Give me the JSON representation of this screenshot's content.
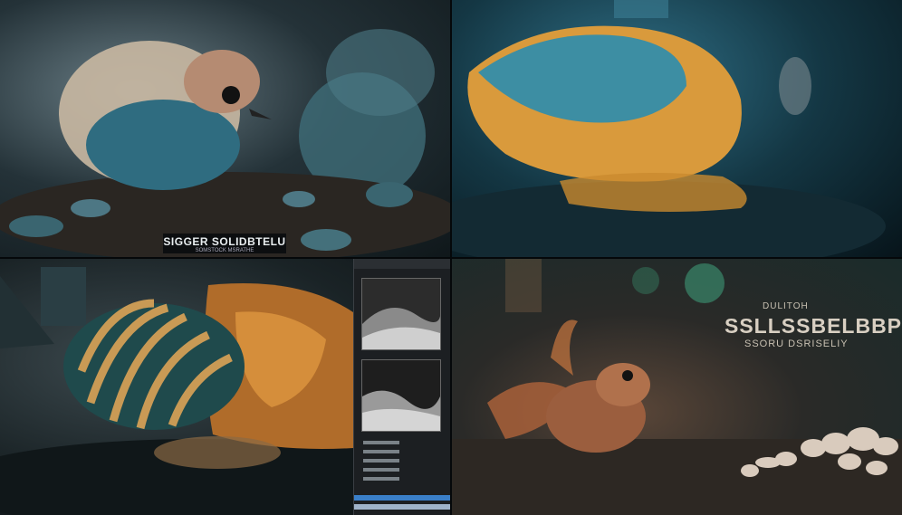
{
  "panels": {
    "top_left": {
      "caption_title": "SIGGER SOLIDBTELU",
      "caption_sub": "SOMSTOCK MSRATHE"
    },
    "bottom_right": {
      "small_text": "DULITOH",
      "big_text": "SSLLSSBELBBP",
      "sub_text": "SSORU DSRISELIY"
    }
  },
  "colors": {
    "teal": "#3e8aa0",
    "gold": "#e0a13a",
    "editor_bg": "#1f2326",
    "accent_blue": "#3a7fc9"
  }
}
